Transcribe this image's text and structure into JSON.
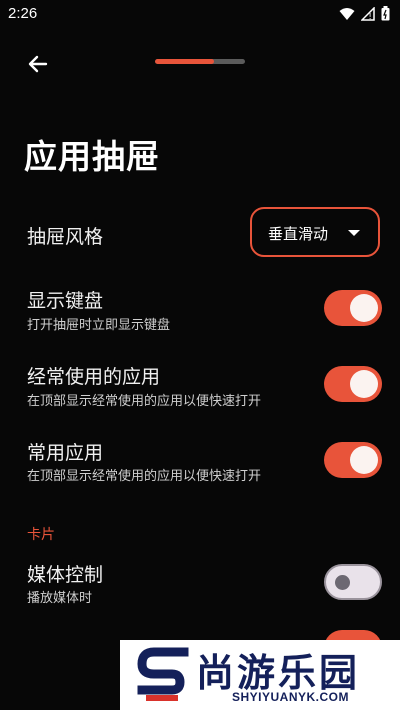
{
  "status": {
    "time": "2:26"
  },
  "header": {
    "progress": 0.65
  },
  "page": {
    "title": "应用抽屉"
  },
  "drawer_style": {
    "label": "抽屉风格",
    "value": "垂直滑动"
  },
  "settings": [
    {
      "title": "显示键盘",
      "subtitle": "打开抽屉时立即显示键盘",
      "enabled": true
    },
    {
      "title": "经常使用的应用",
      "subtitle": "在顶部显示经常使用的应用以便快速打开",
      "enabled": true
    },
    {
      "title": "常用应用",
      "subtitle": "在顶部显示经常使用的应用以便快速打开",
      "enabled": true
    }
  ],
  "cards_section": {
    "label": "卡片"
  },
  "card_settings": [
    {
      "title": "媒体控制",
      "subtitle": "播放媒体时",
      "enabled": false
    }
  ],
  "watermark": {
    "text": "尚游乐园",
    "url": "SHYIYUANYK.COM"
  },
  "colors": {
    "accent": "#e8543a",
    "background": "#070707",
    "watermark": "#14205a"
  }
}
